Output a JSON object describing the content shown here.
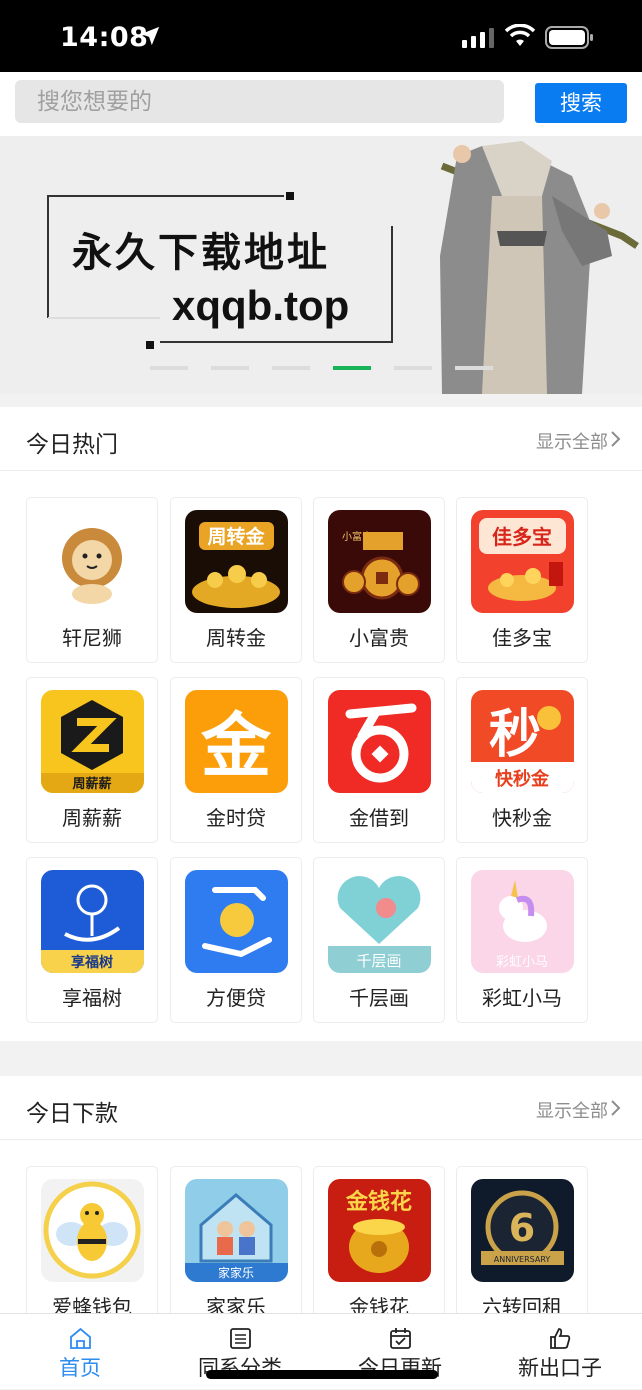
{
  "status": {
    "time": "14:08"
  },
  "search": {
    "placeholder": "搜您想要的",
    "button": "搜索"
  },
  "banner": {
    "line1": "永久下载地址",
    "line2": "xqqb.top",
    "active_dot": 4,
    "dot_count": 6
  },
  "hot": {
    "title": "今日热门",
    "more": "显示全部",
    "items": [
      {
        "label": "轩尼狮",
        "icon": "lion-icon"
      },
      {
        "label": "周转金",
        "icon": "gold-coins-icon",
        "icon_text": "周转金"
      },
      {
        "label": "小富贵",
        "icon": "coins-icon",
        "icon_text": "小富贵"
      },
      {
        "label": "佳多宝",
        "icon": "red-envelope-icon",
        "icon_text": "佳多宝"
      },
      {
        "label": "周薪薪",
        "icon": "z-logo-icon",
        "icon_text": "周薪薪"
      },
      {
        "label": "金时贷",
        "icon": "gold-char-icon",
        "icon_text": "金"
      },
      {
        "label": "金借到",
        "icon": "hundred-icon"
      },
      {
        "label": "快秒金",
        "icon": "second-char-icon",
        "icon_text": "秒",
        "icon_sub": "快秒金"
      },
      {
        "label": "享福树",
        "icon": "money-tree-icon",
        "icon_text": "享福树"
      },
      {
        "label": "方便贷",
        "icon": "hand-coin-icon"
      },
      {
        "label": "千层画",
        "icon": "heart-balloon-icon",
        "icon_text": "千层画"
      },
      {
        "label": "彩虹小马",
        "icon": "unicorn-icon",
        "icon_text": "彩虹小马"
      }
    ]
  },
  "new_today": {
    "title": "今日下款",
    "more": "显示全部",
    "items": [
      {
        "label": "爱蜂钱包",
        "icon": "bee-icon"
      },
      {
        "label": "家家乐",
        "icon": "family-house-icon",
        "icon_text": "家家乐"
      },
      {
        "label": "金钱花",
        "icon": "gold-pot-icon",
        "icon_text": "金钱花"
      },
      {
        "label": "六转回租",
        "icon": "anniversary-badge-icon",
        "icon_text": "6",
        "icon_sub": "ANNIVERSARY"
      }
    ]
  },
  "tabs": [
    {
      "label": "首页",
      "icon": "home-icon",
      "active": true
    },
    {
      "label": "同系分类",
      "icon": "list-icon",
      "active": false
    },
    {
      "label": "今日更新",
      "icon": "calendar-icon",
      "active": false
    },
    {
      "label": "新出口子",
      "icon": "thumbs-up-icon",
      "active": false
    }
  ],
  "colors": {
    "accent": "#0a7cf2",
    "active_tab": "#2d8cf0",
    "active_dot": "#19b35a"
  }
}
